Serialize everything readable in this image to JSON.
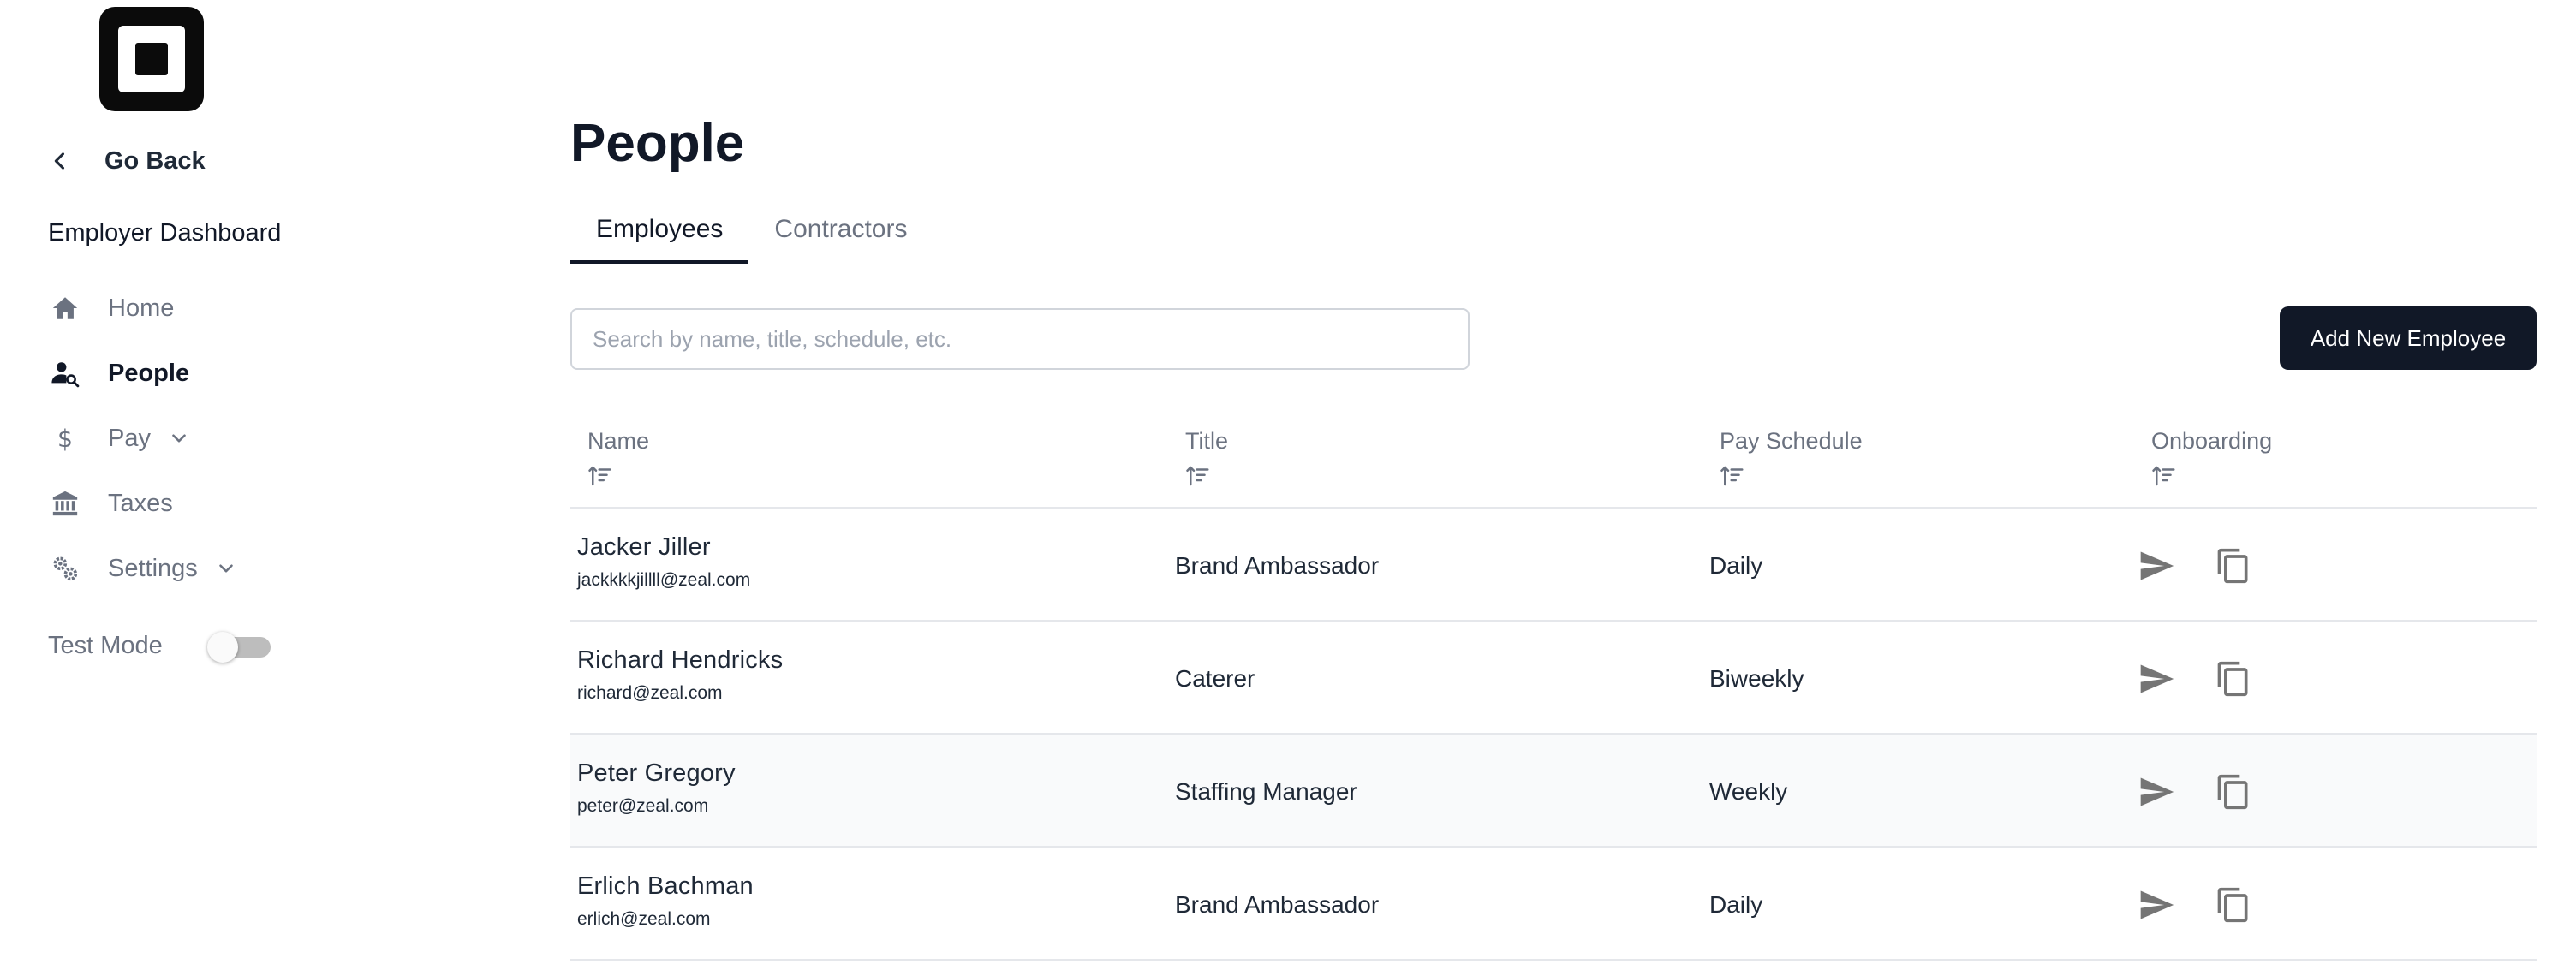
{
  "sidebar": {
    "go_back": "Go Back",
    "section_title": "Employer Dashboard",
    "items": [
      {
        "label": "Home",
        "icon": "home-icon"
      },
      {
        "label": "People",
        "icon": "people-search-icon"
      },
      {
        "label": "Pay",
        "icon": "dollar-icon"
      },
      {
        "label": "Taxes",
        "icon": "bank-icon"
      },
      {
        "label": "Settings",
        "icon": "gears-icon"
      }
    ],
    "active_item": "People",
    "test_mode_label": "Test Mode",
    "test_mode_on": false
  },
  "main": {
    "title": "People",
    "tabs": [
      {
        "label": "Employees",
        "active": true
      },
      {
        "label": "Contractors",
        "active": false
      }
    ],
    "search_placeholder": "Search by name, title, schedule, etc.",
    "search_value": "",
    "add_button": "Add New Employee"
  },
  "table": {
    "columns": [
      "Name",
      "Title",
      "Pay Schedule",
      "Onboarding"
    ],
    "rows": [
      {
        "name": "Jacker Jiller",
        "email": "jackkkkjillll@zeal.com",
        "title": "Brand Ambassador",
        "schedule": "Daily"
      },
      {
        "name": "Richard Hendricks",
        "email": "richard@zeal.com",
        "title": "Caterer",
        "schedule": "Biweekly"
      },
      {
        "name": "Peter Gregory",
        "email": "peter@zeal.com",
        "title": "Staffing Manager",
        "schedule": "Weekly"
      },
      {
        "name": "Erlich Bachman",
        "email": "erlich@zeal.com",
        "title": "Brand Ambassador",
        "schedule": "Daily"
      }
    ]
  },
  "colors": {
    "primary": "#111827",
    "muted_text": "#6b7280",
    "icon_gray": "#6b7280",
    "border": "#e5e7eb",
    "row_highlight": "#f9fafb"
  }
}
